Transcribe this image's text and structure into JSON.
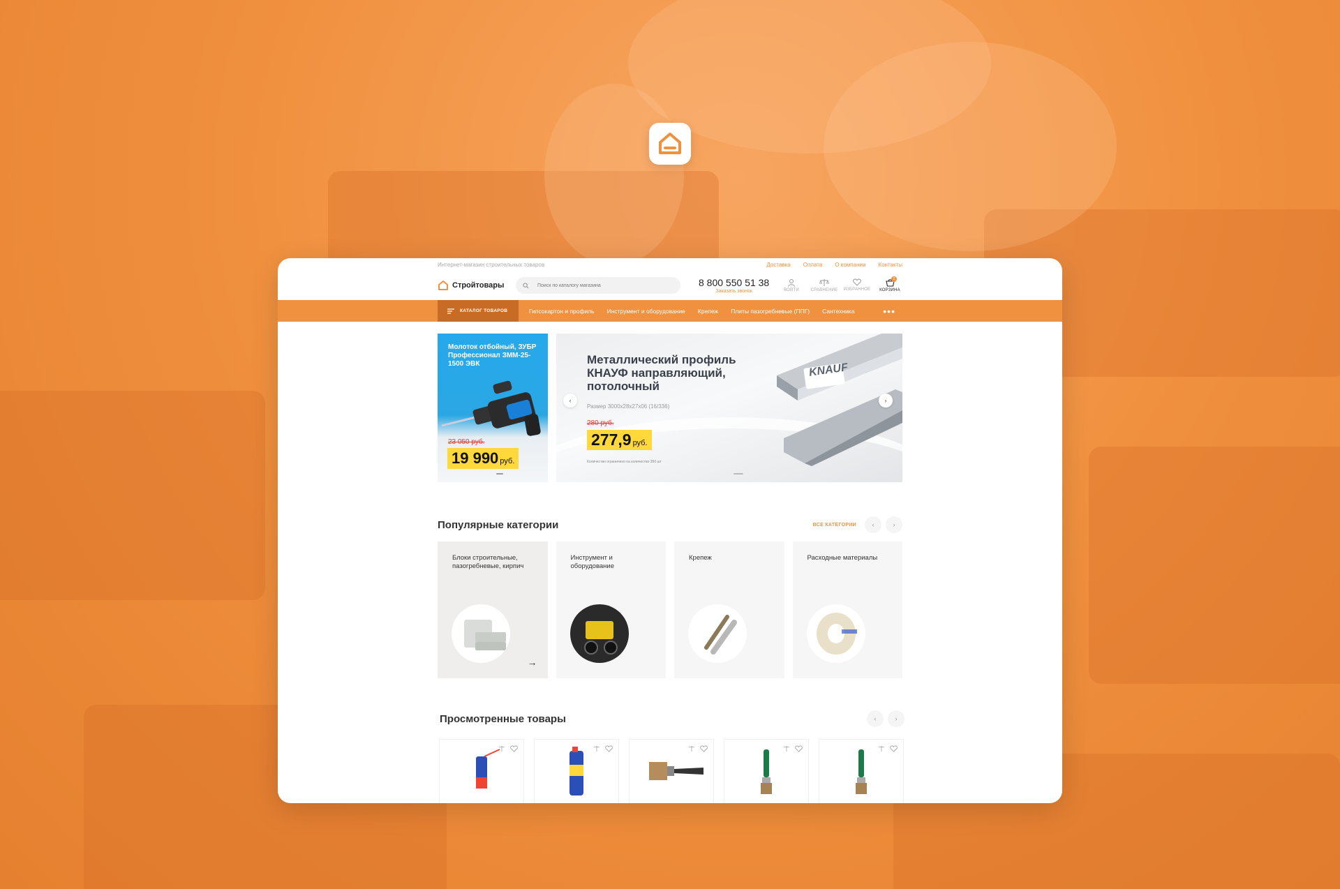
{
  "site": {
    "tagline": "Интернет-магазин строительных товаров",
    "top_links": [
      "Доставка",
      "Оплата",
      "О компании",
      "Контакты"
    ],
    "logo_text": "Стройтовары"
  },
  "search": {
    "placeholder": "Поиск по каталогу магазина"
  },
  "contact": {
    "phone": "8 800 550 51 38",
    "callback": "Заказать звонок"
  },
  "header_icons": [
    {
      "icon": "user-icon",
      "label": "ВОЙТИ"
    },
    {
      "icon": "scales-icon",
      "label": "СРАВНЕНИЕ"
    },
    {
      "icon": "heart-icon",
      "label": "ИЗБРАННОЕ"
    },
    {
      "icon": "basket-icon",
      "label": "КОРЗИНА",
      "badge": "2"
    }
  ],
  "nav": {
    "catalog_label": "КАТАЛОГ ТОВАРОВ",
    "items": [
      "Гипсокартон и профиль",
      "Инструмент и оборудование",
      "Крепеж",
      "Плиты пазогребневые (ППГ)",
      "Сантехника"
    ],
    "more": "•••"
  },
  "promo_small": {
    "title": "Молоток отбойный, ЗУБР Профессионал ЗММ-25-1500 ЭВК",
    "old_price": "23 050 руб.",
    "price": "19 990",
    "currency": "руб."
  },
  "promo_main": {
    "title": "Металлический профиль КНАУФ направляющий, потолочный",
    "size": "Размер 3000х28х27х06 (16/336)",
    "old_price": "280 руб.",
    "price": "277,9",
    "currency": "руб.",
    "fine_print": "Количество ограничено на количество 350 шт",
    "brand": "KNAUF"
  },
  "popular": {
    "title": "Популярные категории",
    "all_label": "ВСЕ КАТЕГОРИИ",
    "items": [
      "Блоки строительные, пазогребневые, кирпич",
      "Инструмент и оборудование",
      "Крепеж",
      "Расходные материалы"
    ]
  },
  "viewed": {
    "title": "Просмотренные товары"
  },
  "colors": {
    "accent": "#f0913f",
    "accent_dark": "#c86c25",
    "price_bg": "#ffd83b",
    "old_price": "#e33a2c"
  }
}
